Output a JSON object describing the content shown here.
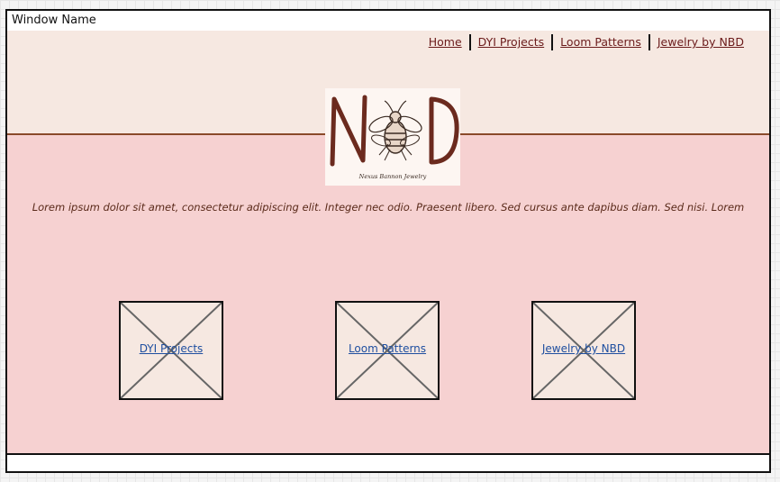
{
  "window": {
    "title": "Window Name"
  },
  "nav": {
    "items": [
      {
        "label": "Home"
      },
      {
        "label": "DYI Projects"
      },
      {
        "label": "Loom Patterns"
      },
      {
        "label": "Jewelry by NBD"
      }
    ]
  },
  "logo": {
    "icon": "bee-logo-icon",
    "tagline": "Nexus Bannon Jewelry"
  },
  "intro": {
    "text": "Lorem ipsum dolor sit amet, consectetur adipiscing elit. Integer nec odio. Praesent libero. Sed cursus ante dapibus diam. Sed nisi. Lorem"
  },
  "tiles": [
    {
      "label": "DYI Projects"
    },
    {
      "label": "Loom Patterns"
    },
    {
      "label": "Jewelry by NBD"
    }
  ],
  "colors": {
    "header_bg": "#f6e8e1",
    "content_bg": "#f6d1d1",
    "nav_link": "#6b1b1b",
    "tile_link": "#1f4fa0",
    "accent_brown": "#8a4a2a"
  }
}
